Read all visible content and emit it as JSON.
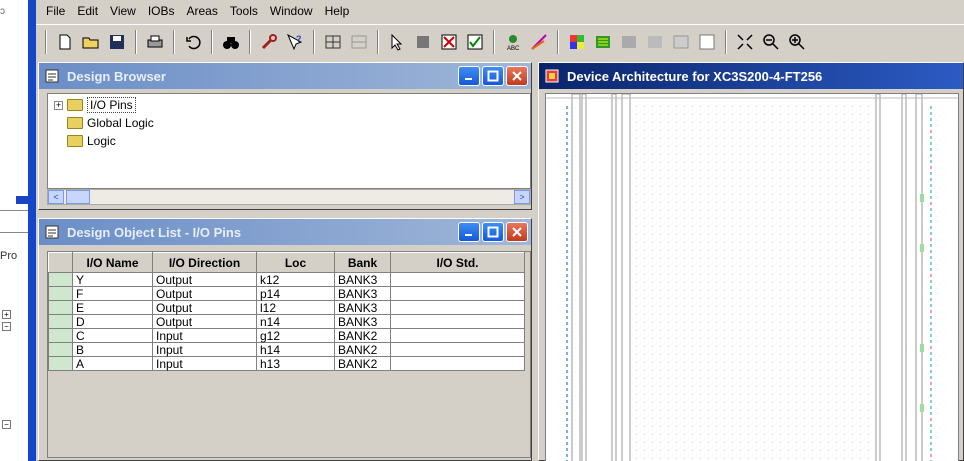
{
  "menu": [
    "File",
    "Edit",
    "View",
    "IOBs",
    "Areas",
    "Tools",
    "Window",
    "Help"
  ],
  "left_strip": {
    "label": "Pro"
  },
  "design_browser": {
    "title": "Design Browser",
    "tree": [
      {
        "label": "I/O Pins",
        "expandable": true,
        "selected": true
      },
      {
        "label": "Global Logic",
        "expandable": false
      },
      {
        "label": "Logic",
        "expandable": false
      }
    ]
  },
  "object_list": {
    "title": "Design Object List - I/O Pins",
    "columns": [
      "I/O Name",
      "I/O Direction",
      "Loc",
      "Bank",
      "I/O Std."
    ],
    "rows": [
      [
        "Y",
        "Output",
        "k12",
        "BANK3",
        ""
      ],
      [
        "F",
        "Output",
        "p14",
        "BANK3",
        ""
      ],
      [
        "E",
        "Output",
        "l12",
        "BANK3",
        ""
      ],
      [
        "D",
        "Output",
        "n14",
        "BANK3",
        ""
      ],
      [
        "C",
        "Input",
        "g12",
        "BANK2",
        ""
      ],
      [
        "B",
        "Input",
        "h14",
        "BANK2",
        ""
      ],
      [
        "A",
        "Input",
        "h13",
        "BANK2",
        ""
      ]
    ]
  },
  "device_arch": {
    "title": "Device Architecture for XC3S200-4-FT256"
  },
  "colors": {
    "active_title": "#0a246a",
    "inactive_title": "#6b8ec7",
    "row_header": "#cfe6cf"
  }
}
